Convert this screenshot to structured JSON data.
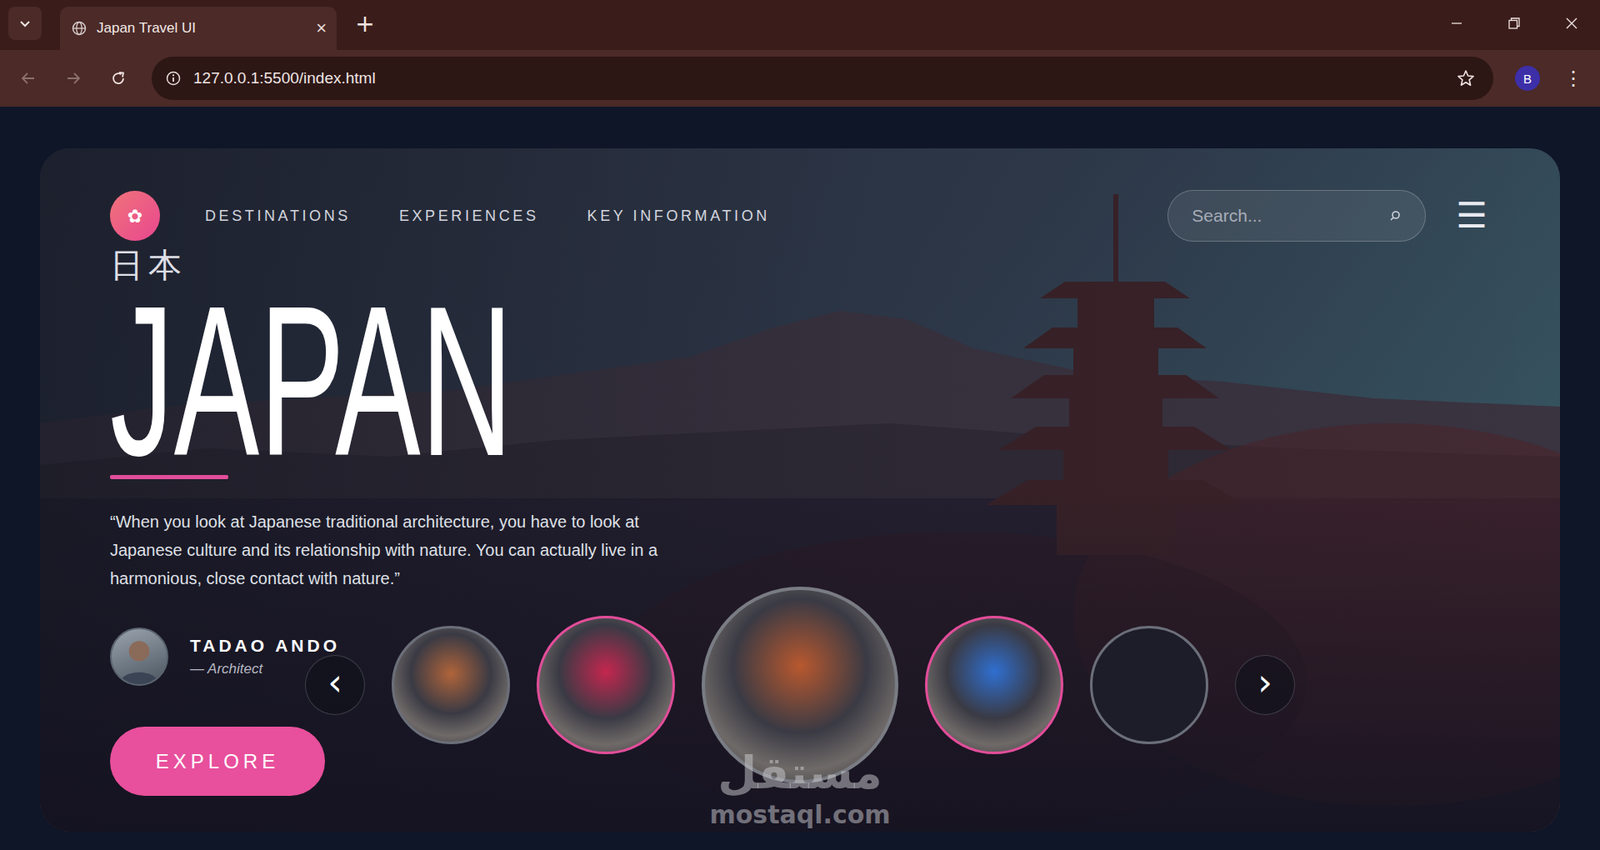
{
  "browser": {
    "tabs": [
      {
        "label": "Japan Travel UI",
        "selected": true,
        "close": "×"
      }
    ],
    "new_tab": "+",
    "can_go_back": false,
    "can_go_forward": false,
    "url": "127.0.0.1:5500/index.html",
    "profile": "B",
    "menu": "⋮"
  },
  "header": {
    "logo": "✿",
    "nav": [
      {
        "label": "DESTINATIONS",
        "selected": false
      },
      {
        "label": "EXPERIENCES",
        "selected": false
      },
      {
        "label": "KEY INFORMATION",
        "selected": false
      }
    ],
    "search": {
      "placeholder": "Search..."
    },
    "menu": "☰"
  },
  "hero": {
    "kanji": "日本",
    "title": "JAPAN",
    "quote": "“When you look at Japanese traditional architecture, you have to look at Japanese culture and its relationship with nature. You can actually live in a harmonious, close contact with nature.”",
    "author": {
      "name": "TADAO ANDO",
      "role": "— Architect"
    },
    "cta": "EXPLORE"
  },
  "carousel": {
    "prev": "‹",
    "next": "›",
    "slides": [
      {
        "kind": "photo",
        "color": "#b0643a",
        "selected": false,
        "highlighted": false
      },
      {
        "kind": "photo",
        "color": "#c4264f",
        "selected": false,
        "highlighted": true
      },
      {
        "kind": "photo",
        "color": "#b8582e",
        "selected": true,
        "highlighted": false
      },
      {
        "kind": "photo",
        "color": "#2f6fd0",
        "selected": false,
        "highlighted": true
      },
      {
        "kind": "empty",
        "color": "#1c1d28",
        "selected": false,
        "highlighted": false
      }
    ]
  },
  "watermark": {
    "arabic": "مستقل",
    "latin": "mostaql.com"
  }
}
